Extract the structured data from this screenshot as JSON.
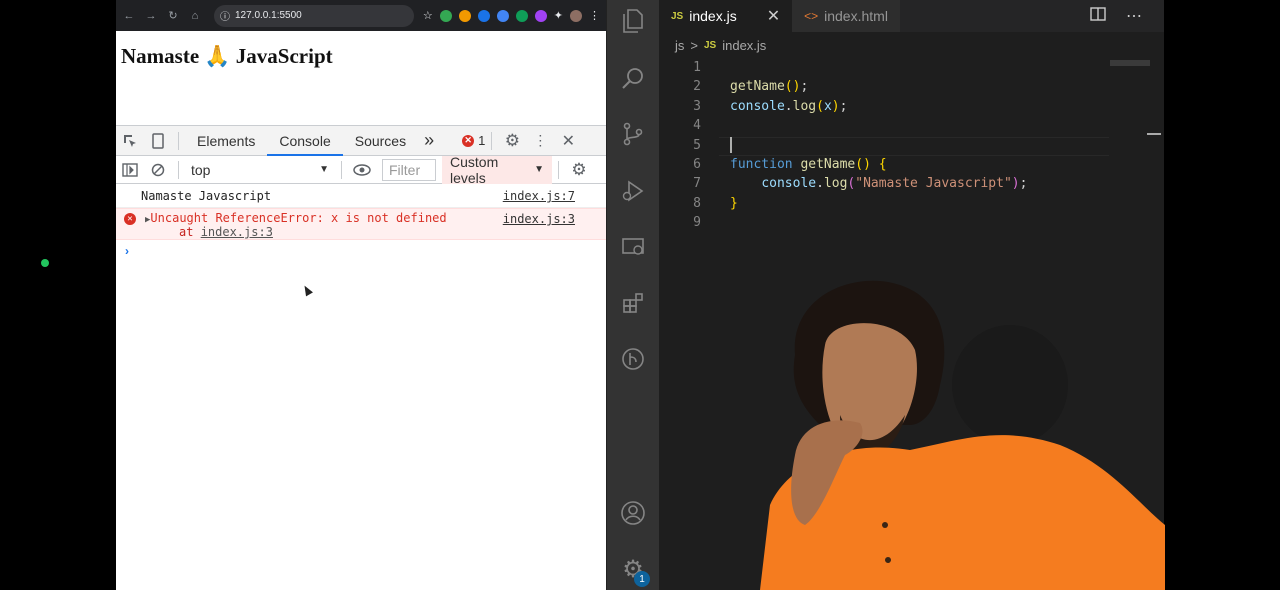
{
  "browser": {
    "url": "127.0.0.1:5500",
    "page_heading": "Namaste 🙏 JavaScript",
    "devtools": {
      "tabs": [
        {
          "label": "Elements"
        },
        {
          "label": "Console"
        },
        {
          "label": "Sources"
        }
      ],
      "more_tabs_glyph": "»",
      "error_count": "1",
      "context": "top",
      "filter_placeholder": "Filter",
      "levels_label": "Custom levels"
    },
    "console": {
      "log_message": "Namaste Javascript",
      "log_source": "index.js:7",
      "error_message": "Uncaught ReferenceError: x is not defined",
      "error_at_prefix": "at",
      "error_at_link": "index.js:3",
      "error_source": "index.js:3",
      "prompt": "›"
    }
  },
  "vscode": {
    "tabs": [
      {
        "label": "index.js",
        "lang": "JS"
      },
      {
        "label": "index.html",
        "lang": "<>"
      }
    ],
    "breadcrumb": {
      "folder": "js",
      "separator": ">",
      "lang": "JS",
      "file": "index.js"
    },
    "badge_count": "1",
    "line_numbers": [
      "1",
      "2",
      "3",
      "4",
      "5",
      "6",
      "7",
      "8",
      "9"
    ],
    "code": {
      "l2_fn": "getName",
      "l2_rest": "();",
      "l3_obj": "console",
      "l3_method": "log",
      "l3_arg": "x",
      "l6_kw": "function",
      "l6_fn": "getName",
      "l6_rest": "()",
      "l7_obj": "console",
      "l7_method": "log",
      "l7_str": "\"Namaste Javascript\"",
      "l8_close": "}"
    }
  }
}
